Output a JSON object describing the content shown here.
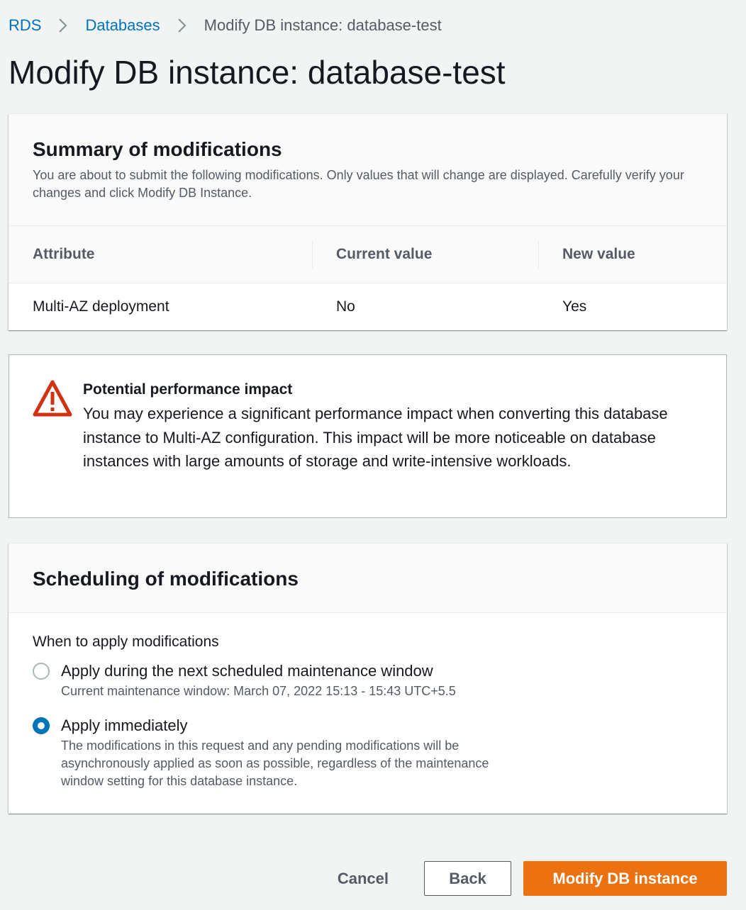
{
  "breadcrumb": {
    "items": [
      "RDS",
      "Databases"
    ],
    "current": "Modify DB instance: database-test"
  },
  "page": {
    "title": "Modify DB instance: database-test"
  },
  "summary": {
    "heading": "Summary of modifications",
    "description": "You are about to submit the following modifications. Only values that will change are displayed. Carefully verify your changes and click Modify DB Instance.",
    "columns": [
      "Attribute",
      "Current value",
      "New value"
    ],
    "rows": [
      [
        "Multi-AZ deployment",
        "No",
        "Yes"
      ]
    ]
  },
  "warning": {
    "icon": "warning-triangle-icon",
    "title": "Potential performance impact",
    "text": "You may experience a significant performance impact when converting this database instance to Multi-AZ configuration. This impact will be more noticeable on database instances with large amounts of storage and write-intensive workloads."
  },
  "scheduling": {
    "heading": "Scheduling of modifications",
    "field_label": "When to apply modifications",
    "options": [
      {
        "label": "Apply during the next scheduled maintenance window",
        "description": "Current maintenance window: March 07, 2022 15:13 - 15:43 UTC+5.5",
        "selected": false
      },
      {
        "label": "Apply immediately",
        "description": "The modifications in this request and any pending modifications will be asynchronously applied as soon as possible, regardless of the maintenance window setting for this database instance.",
        "selected": true
      }
    ]
  },
  "footer": {
    "cancel_label": "Cancel",
    "back_label": "Back",
    "submit_label": "Modify DB instance"
  },
  "colors": {
    "link": "#0073bb",
    "primary_button": "#ec7211",
    "warning": "#d13212",
    "radio_selected": "#0073bb"
  }
}
